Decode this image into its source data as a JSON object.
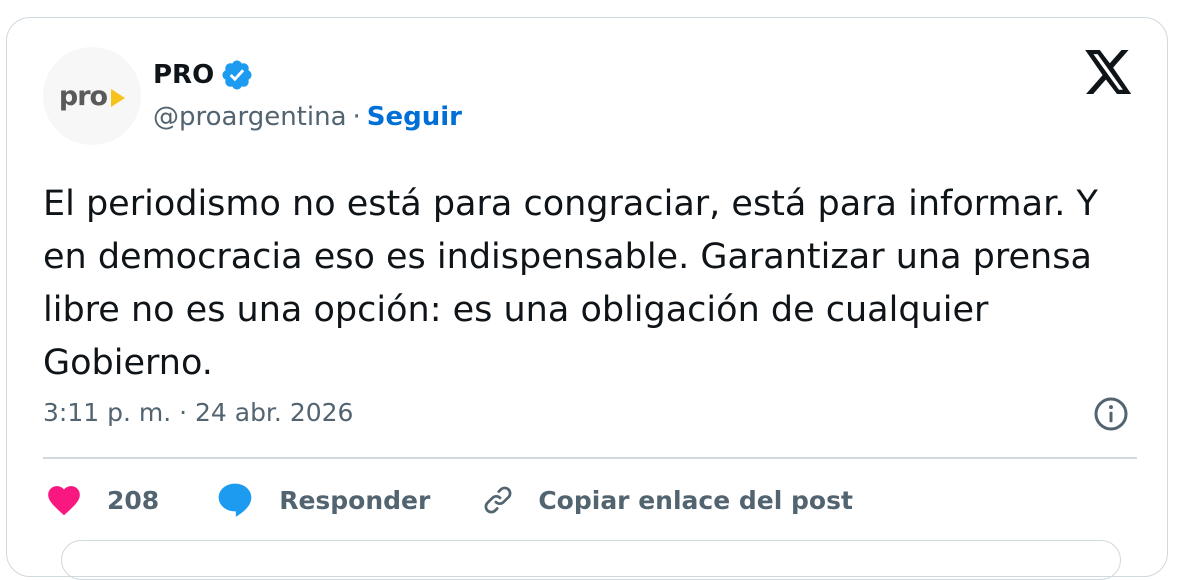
{
  "author": {
    "avatar_text": "pro",
    "display_name": "PRO",
    "handle": "@proargentina",
    "separator": "·",
    "follow_label": "Seguir",
    "verified_icon": "verified-badge-icon"
  },
  "tweet": {
    "text": "El periodismo no está para congraciar, está para informar. Y en democracia eso es indispensable. Garantizar una prensa libre no es una opción: es una obligación de cualquier Gobierno.",
    "timestamp": "3:11 p. m. · 24 abr. 2026"
  },
  "actions": {
    "likes_count": "208",
    "reply_label": "Responder",
    "copy_link_label": "Copiar enlace del post"
  },
  "colors": {
    "like": "#f91880",
    "reply": "#1d9bf0",
    "link": "#006fd6",
    "verified": "#1d9bf0",
    "brand_yellow": "#f7c21b"
  }
}
